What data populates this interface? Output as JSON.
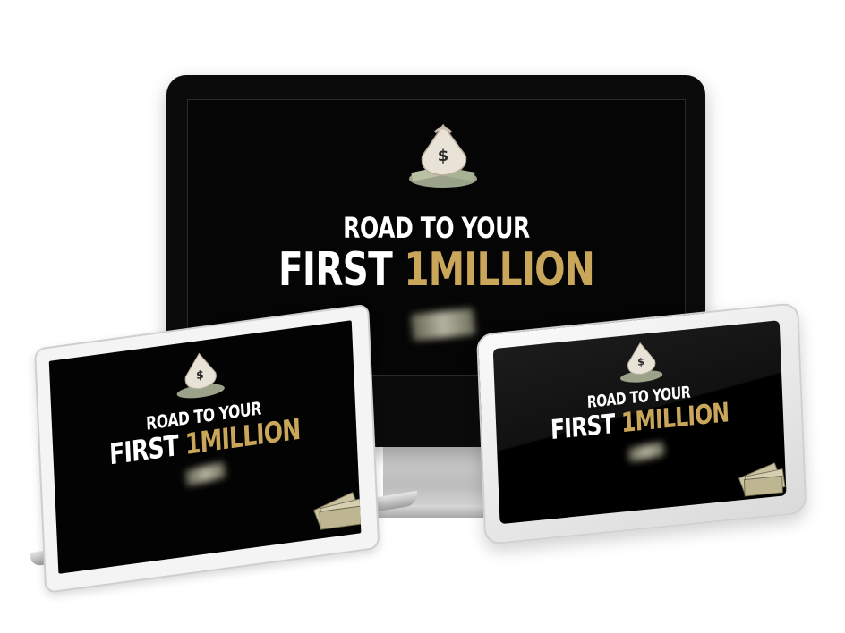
{
  "product": {
    "title_line1": "ROAD TO YOUR",
    "title_line2_white": "FIRST",
    "title_line2_gold": "1MILLION"
  },
  "colors": {
    "background": "#ffffff",
    "screen": "#050505",
    "title_white": "#ffffff",
    "title_gold": "#c9a659",
    "device_silver": "#d0d0d0"
  },
  "icons": {
    "money_bag": "money-bag-icon",
    "cash_stack": "cash-stack-icon"
  }
}
